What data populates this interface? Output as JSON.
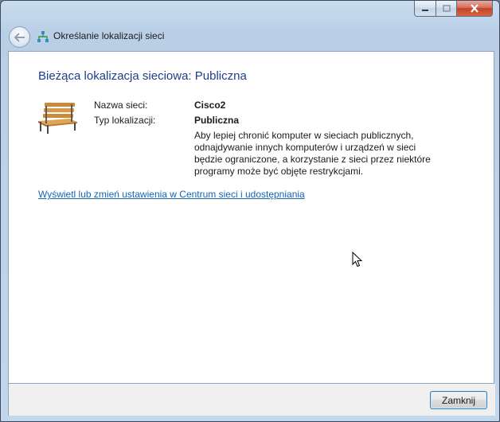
{
  "window": {
    "title": "Określanie lokalizacji sieci",
    "caption_buttons": [
      "minimize-icon",
      "maximize-icon",
      "close-icon"
    ]
  },
  "main": {
    "heading": "Bieżąca lokalizacja sieciowa: Publiczna",
    "icon": "park-bench-icon",
    "network_name_label": "Nazwa sieci:",
    "network_name_value": "Cisco2",
    "location_type_label": "Typ lokalizacji:",
    "location_type_value": "Publiczna",
    "description_lines": [
      "Aby lepiej chronić komputer w sieciach publicznych,",
      "odnajdywanie innych komputerów i urządzeń w sieci",
      "będzie ograniczone, a korzystanie z sieci przez niektóre",
      "programy może być objęte restrykcjami."
    ],
    "link": "Wyświetl lub zmień ustawienia w Centrum sieci i udostępniania"
  },
  "footer": {
    "close_label": "Zamknij"
  }
}
